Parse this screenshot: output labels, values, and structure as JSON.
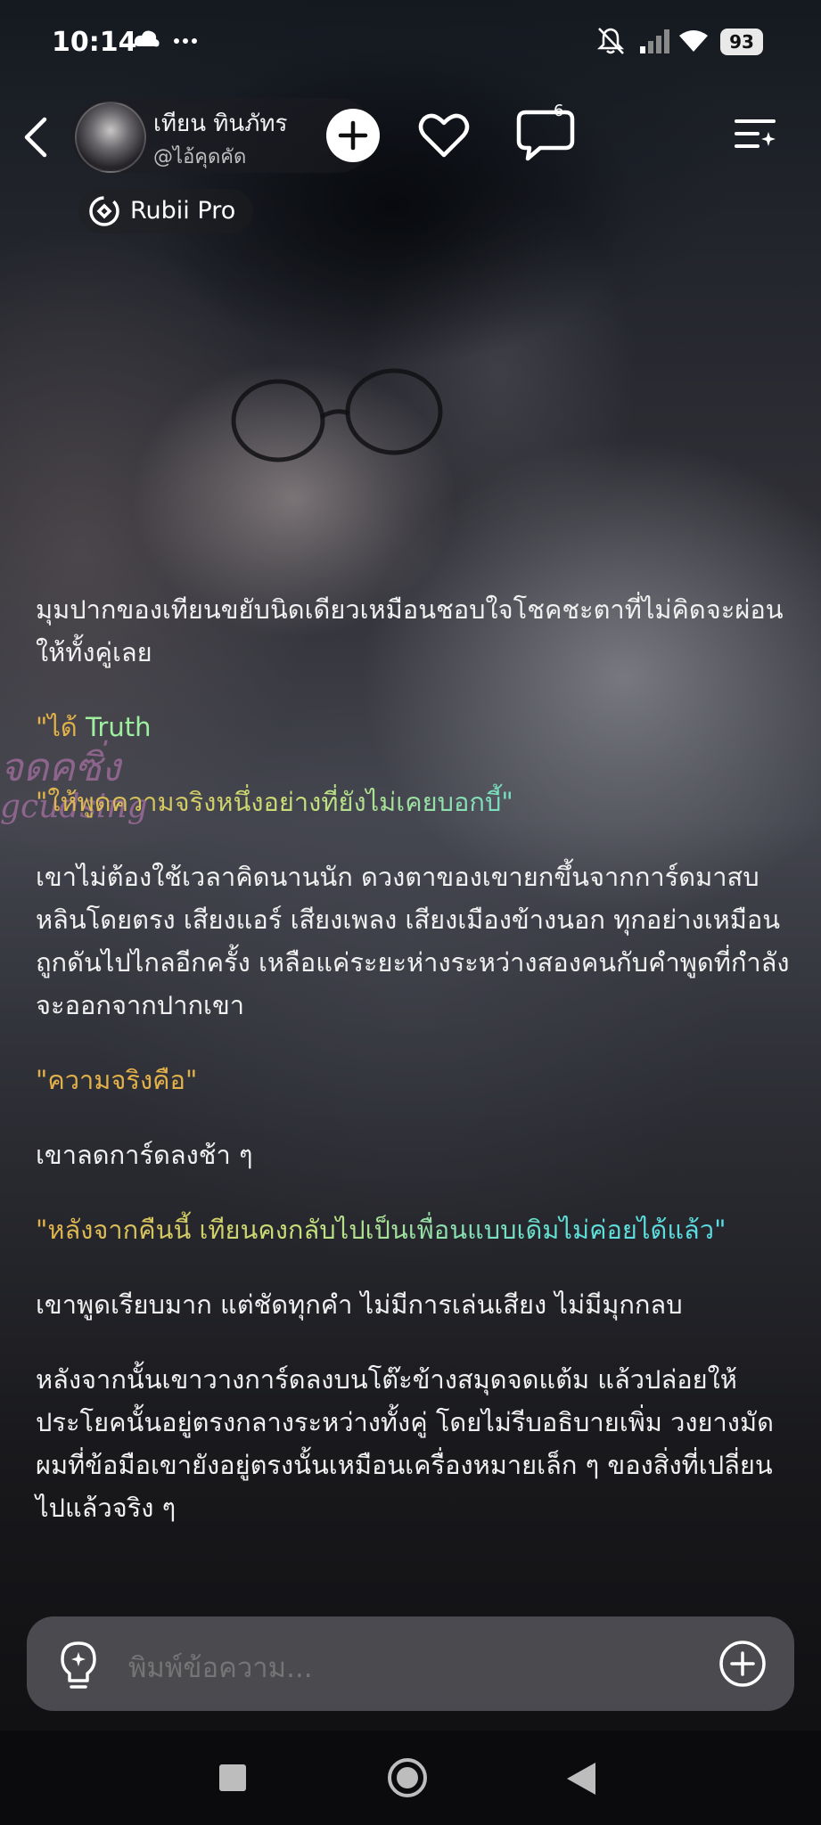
{
  "status_bar": {
    "time": "10:14",
    "battery": "93"
  },
  "header": {
    "character_name": "เทียน ทินภัทร",
    "character_handle": "@ไอ้คุดคัด",
    "comment_count": "6",
    "pro_badge": "Rubii Pro"
  },
  "watermark": {
    "line1": "จดคซิ่ง",
    "line2": "gcudsing"
  },
  "story": {
    "p1": "มุมปากของเทียนขยับนิดเดียวเหมือนชอบใจโชคชะตาที่ไม่คิดจะผ่อนให้ทั้งคู่เลย",
    "p2_a": "\"ได้ ",
    "p2_b": "Truth",
    "p3": "\"ให้พูดความจริงหนึ่งอย่างที่ยังไม่เคยบอกบี้\"",
    "p4": "เขาไม่ต้องใช้เวลาคิดนานนัก ดวงตาของเขายกขึ้นจากการ์ดมาสบหลินโดยตรง เสียงแอร์ เสียงเพลง เสียงเมืองข้างนอก ทุกอย่างเหมือนถูกดันไปไกลอีกครั้ง เหลือแค่ระยะห่างระหว่างสองคนกับคำพูดที่กำลังจะออกจากปากเขา",
    "p5": "\"ความจริงคือ\"",
    "p6": "เขาลดการ์ดลงช้า ๆ",
    "p7": "\"หลังจากคืนนี้ เทียนคงกลับไปเป็นเพื่อนแบบเดิมไม่ค่อยได้แล้ว\"",
    "p8": "เขาพูดเรียบมาก แต่ชัดทุกคำ ไม่มีการเล่นเสียง ไม่มีมุกกลบ",
    "p9": "หลังจากนั้นเขาวางการ์ดลงบนโต๊ะข้างสมุดจดแต้ม แล้วปล่อยให้ประโยคนั้นอยู่ตรงกลางระหว่างทั้งคู่ โดยไม่รีบอธิบายเพิ่ม วงยางมัดผมที่ข้อมือเขายังอยู่ตรงนั้นเหมือนเครื่องหมายเล็ก ๆ ของสิ่งที่เปลี่ยนไปแล้วจริง ๆ"
  },
  "input": {
    "placeholder": "พิมพ์ข้อความ..."
  },
  "icons": [
    "bell-off-icon",
    "signal-icon",
    "wifi-icon",
    "back-icon",
    "add-icon",
    "heart-icon",
    "comment-icon",
    "menu-icon",
    "rubii-icon",
    "bulb-icon",
    "plus-icon",
    "recent-apps-icon",
    "home-icon",
    "nav-back-icon"
  ],
  "colors": {
    "quote": "#e2b14a",
    "highlight_green": "#9ef0a0",
    "highlight_cyan": "#58dbe8"
  }
}
